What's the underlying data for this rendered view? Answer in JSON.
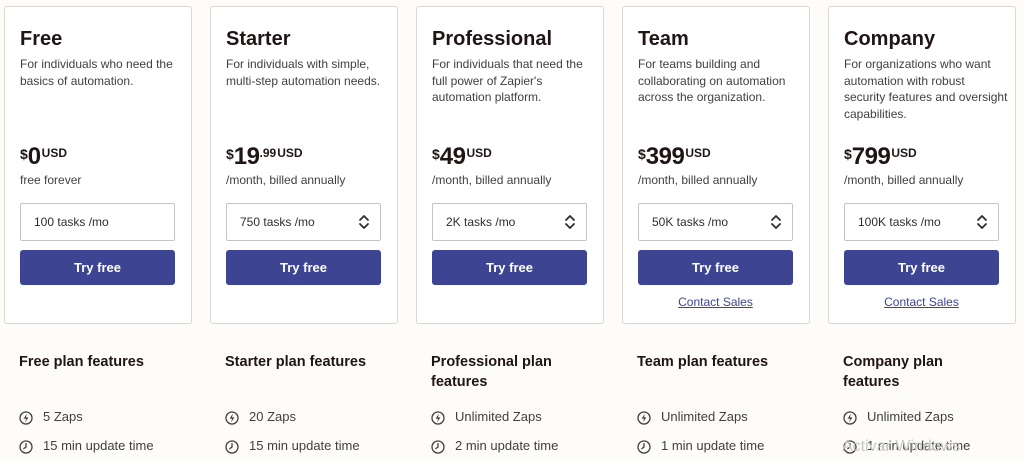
{
  "plans": [
    {
      "name": "Free",
      "description": "For individuals who need the basics of automation.",
      "currency_symbol": "$",
      "price": "0",
      "cents": "",
      "unit": "USD",
      "billing": "free forever",
      "tasks": "100 tasks /mo",
      "has_chevron": false,
      "button": "Try free",
      "contact": "",
      "features_title": "Free plan features",
      "features": [
        "5 Zaps",
        "15 min update time"
      ]
    },
    {
      "name": "Starter",
      "description": "For individuals with simple, multi-step automation needs.",
      "currency_symbol": "$",
      "price": "19",
      "cents": ".99",
      "unit": "USD",
      "billing": "/month, billed annually",
      "tasks": "750 tasks /mo",
      "has_chevron": true,
      "button": "Try free",
      "contact": "",
      "features_title": "Starter plan features",
      "features": [
        "20 Zaps",
        "15 min update time"
      ]
    },
    {
      "name": "Professional",
      "description": "For individuals that need the full power of Zapier's automation platform.",
      "currency_symbol": "$",
      "price": "49",
      "cents": "",
      "unit": "USD",
      "billing": "/month, billed annually",
      "tasks": "2K tasks /mo",
      "has_chevron": true,
      "button": "Try free",
      "contact": "",
      "features_title": "Professional plan features",
      "features": [
        "Unlimited Zaps",
        "2 min update time"
      ]
    },
    {
      "name": "Team",
      "description": "For teams building and collaborating on automation across the organization.",
      "currency_symbol": "$",
      "price": "399",
      "cents": "",
      "unit": "USD",
      "billing": "/month, billed annually",
      "tasks": "50K tasks /mo",
      "has_chevron": true,
      "button": "Try free",
      "contact": "Contact Sales",
      "features_title": "Team plan features",
      "features": [
        "Unlimited Zaps",
        "1 min update time"
      ]
    },
    {
      "name": "Company",
      "description": "For organizations who want automation with robust security features and oversight capabilities.",
      "currency_symbol": "$",
      "price": "799",
      "cents": "",
      "unit": "USD",
      "billing": "/month, billed annually",
      "tasks": "100K tasks /mo",
      "has_chevron": true,
      "button": "Try free",
      "contact": "Contact Sales",
      "features_title": "Company plan features",
      "features": [
        "Unlimited Zaps",
        "1 min update time"
      ]
    }
  ],
  "icons": {
    "feature_1": "lightning-icon",
    "feature_2": "clock-icon",
    "select": "chevron-up-down-icon"
  },
  "colors": {
    "accent": "#3d4592",
    "background": "#fdfcf9"
  },
  "watermark": "Activar Windows"
}
